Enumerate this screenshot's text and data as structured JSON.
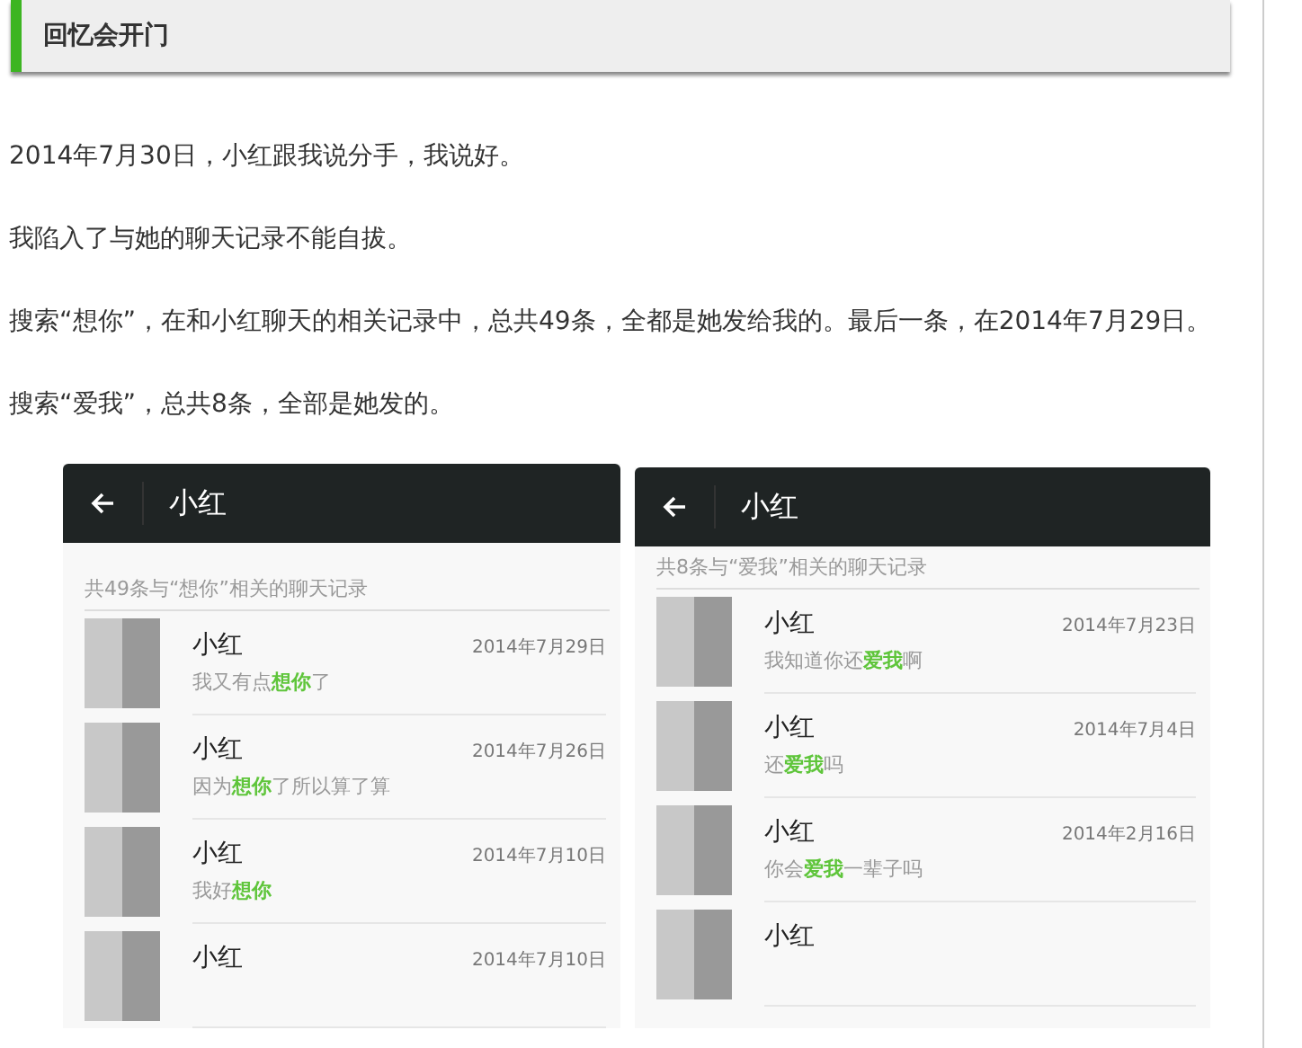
{
  "section_title": "回忆会开门",
  "paragraphs": [
    "2014年7月30日，小红跟我说分手，我说好。",
    "我陷入了与她的聊天记录不能自拔。",
    "搜索“想你”，在和小红聊天的相关记录中，总共49条，全都是她发给我的。最后一条，在2014年7月29日。",
    "搜索“爱我”，总共8条，全部是她发的。"
  ],
  "phone_screens": [
    {
      "title": "小红",
      "result_summary": "共49条与“想你”相关的聊天记录",
      "results": [
        {
          "name": "小红",
          "date": "2014年7月29日",
          "message": {
            "before": "我又有点",
            "keyword": "想你",
            "after": "了"
          }
        },
        {
          "name": "小红",
          "date": "2014年7月26日",
          "message": {
            "before": "因为",
            "keyword": "想你",
            "after": "了所以算了算"
          }
        },
        {
          "name": "小红",
          "date": "2014年7月10日",
          "message": {
            "before": "我好",
            "keyword": "想你"
          }
        },
        {
          "name": "小红",
          "date": "2014年7月10日"
        }
      ]
    },
    {
      "title": "小红",
      "result_summary": "共8条与“爱我”相关的聊天记录",
      "results": [
        {
          "name": "小红",
          "date": "2014年7月23日",
          "message": {
            "before": "我知道你还",
            "keyword": "爱我",
            "after": "啊"
          }
        },
        {
          "name": "小红",
          "date": "2014年7月4日",
          "message": {
            "before": "还",
            "keyword": "爱我",
            "after": "吗"
          }
        },
        {
          "name": "小红",
          "date": "2014年2月16日",
          "message": {
            "before": "你会",
            "keyword": "爱我",
            "after": "一辈子吗"
          }
        },
        {
          "name": "小红"
        }
      ]
    }
  ]
}
